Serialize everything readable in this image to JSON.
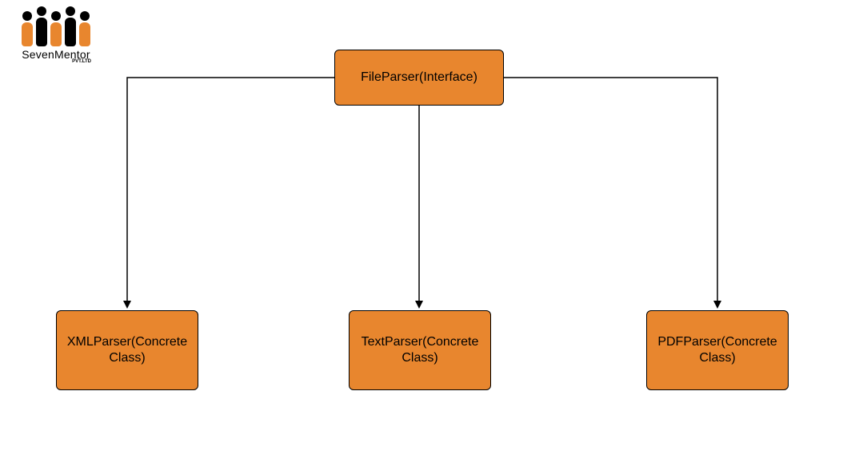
{
  "logo": {
    "brand": "SevenMentor",
    "sub": "PVT.LTD"
  },
  "diagram": {
    "interface": {
      "label": "FileParser(Interface)"
    },
    "implementations": [
      {
        "label_line1": "XMLParser(Concrete",
        "label_line2": "Class)"
      },
      {
        "label_line1": "TextParser(Concrete",
        "label_line2": "Class)"
      },
      {
        "label_line1": "PDFParser(Concrete",
        "label_line2": "Class)"
      }
    ]
  },
  "chart_data": {
    "type": "diagram",
    "title": "",
    "root": "FileParser(Interface)",
    "children": [
      "XMLParser(Concrete Class)",
      "TextParser(Concrete Class)",
      "PDFParser(Concrete Class)"
    ]
  }
}
